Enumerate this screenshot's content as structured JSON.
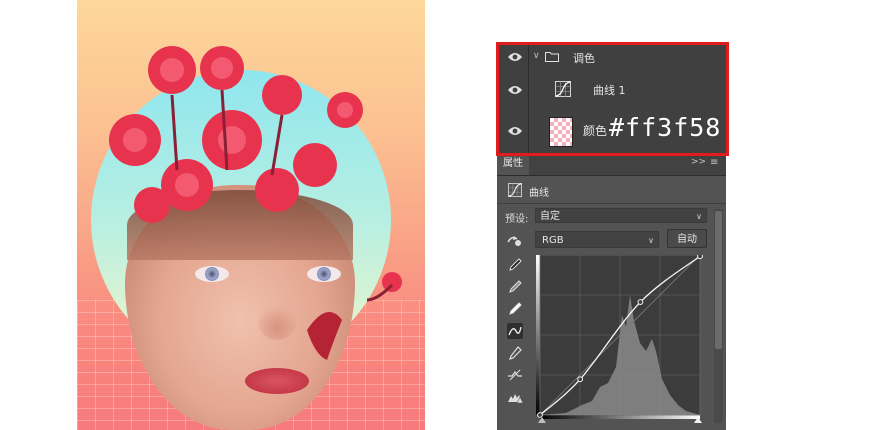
{
  "layers": [
    {
      "name": "调色",
      "kind": "group",
      "visible": true,
      "expanded": true
    },
    {
      "name": "曲线 1",
      "kind": "curves-adjustment",
      "visible": true
    },
    {
      "name": "颜色",
      "kind": "fill",
      "visible": true,
      "annotation": "#ff3f58"
    }
  ],
  "properties": {
    "tab_label": "属性",
    "panel_title": "曲线",
    "preset_label": "预设:",
    "preset_value": "自定",
    "channel_value": "RGB",
    "auto_label": "自动"
  },
  "curve": {
    "input_output_points": [
      [
        0,
        0
      ],
      [
        64,
        57
      ],
      [
        160,
        180
      ],
      [
        255,
        253
      ]
    ]
  },
  "colors": {
    "highlight_border": "#e01c1c",
    "fill_color": "#ff3f58",
    "panel_bg": "#535353"
  },
  "icons": [
    "eye-icon",
    "folder-icon",
    "curves-icon",
    "target-adjust-icon",
    "eyedropper-black-icon",
    "eyedropper-gray-icon",
    "eyedropper-white-icon",
    "curve-points-icon",
    "pencil-icon",
    "smooth-icon",
    "clipping-warning-icon"
  ]
}
